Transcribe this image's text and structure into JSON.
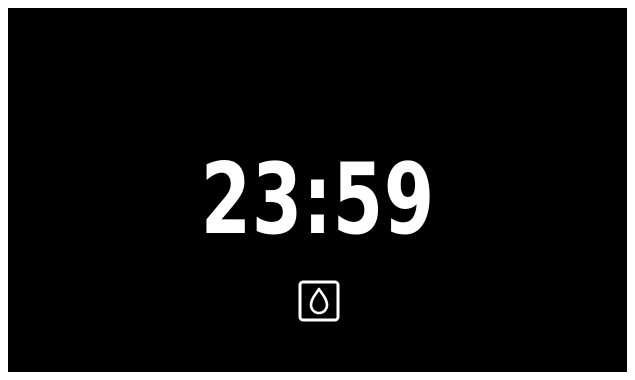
{
  "display": {
    "time": "23:59",
    "mode_icon": "water-drop-icon",
    "background_color": "#000000",
    "foreground_color": "#ffffff"
  }
}
